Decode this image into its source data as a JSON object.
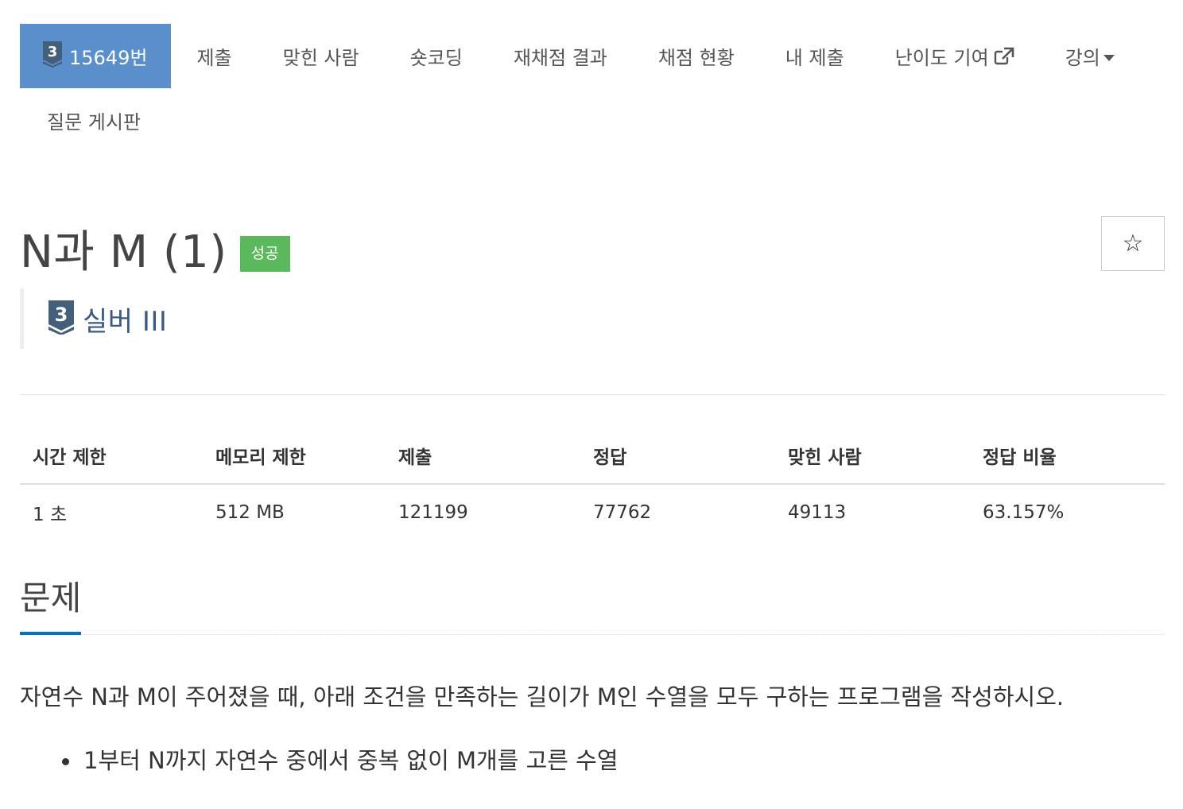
{
  "nav": {
    "active_tab": "15649번",
    "tier_digit": "3",
    "items": [
      "제출",
      "맞힌 사람",
      "숏코딩",
      "재채점 결과",
      "채점 현황",
      "내 제출",
      "난이도 기여",
      "강의"
    ],
    "row2_item": "질문 게시판",
    "external_icon": "external-link-icon",
    "dropdown_icon": "caret-down-icon"
  },
  "problem": {
    "title": "N과 M (1)",
    "status_badge": "성공",
    "star_icon": "star-icon",
    "star_glyph": "☆",
    "tier_digit": "3",
    "tier_label": "실버 III"
  },
  "info_table": {
    "headers": [
      "시간 제한",
      "메모리 제한",
      "제출",
      "정답",
      "맞힌 사람",
      "정답 비율"
    ],
    "values": [
      "1 초",
      "512 MB",
      "121199",
      "77762",
      "49113",
      "63.157%"
    ]
  },
  "section": {
    "title": "문제",
    "description": "자연수 N과 M이 주어졌을 때, 아래 조건을 만족하는 길이가 M인 수열을 모두 구하는 프로그램을 작성하시오.",
    "conditions": [
      "1부터 N까지 자연수 중에서 중복 없이 M개를 고른 수열"
    ]
  },
  "colors": {
    "active_tab_bg": "#5b8fcc",
    "success_badge": "#5cb85c",
    "tier_silver": "#435f7a",
    "section_underline": "#0076c0"
  }
}
